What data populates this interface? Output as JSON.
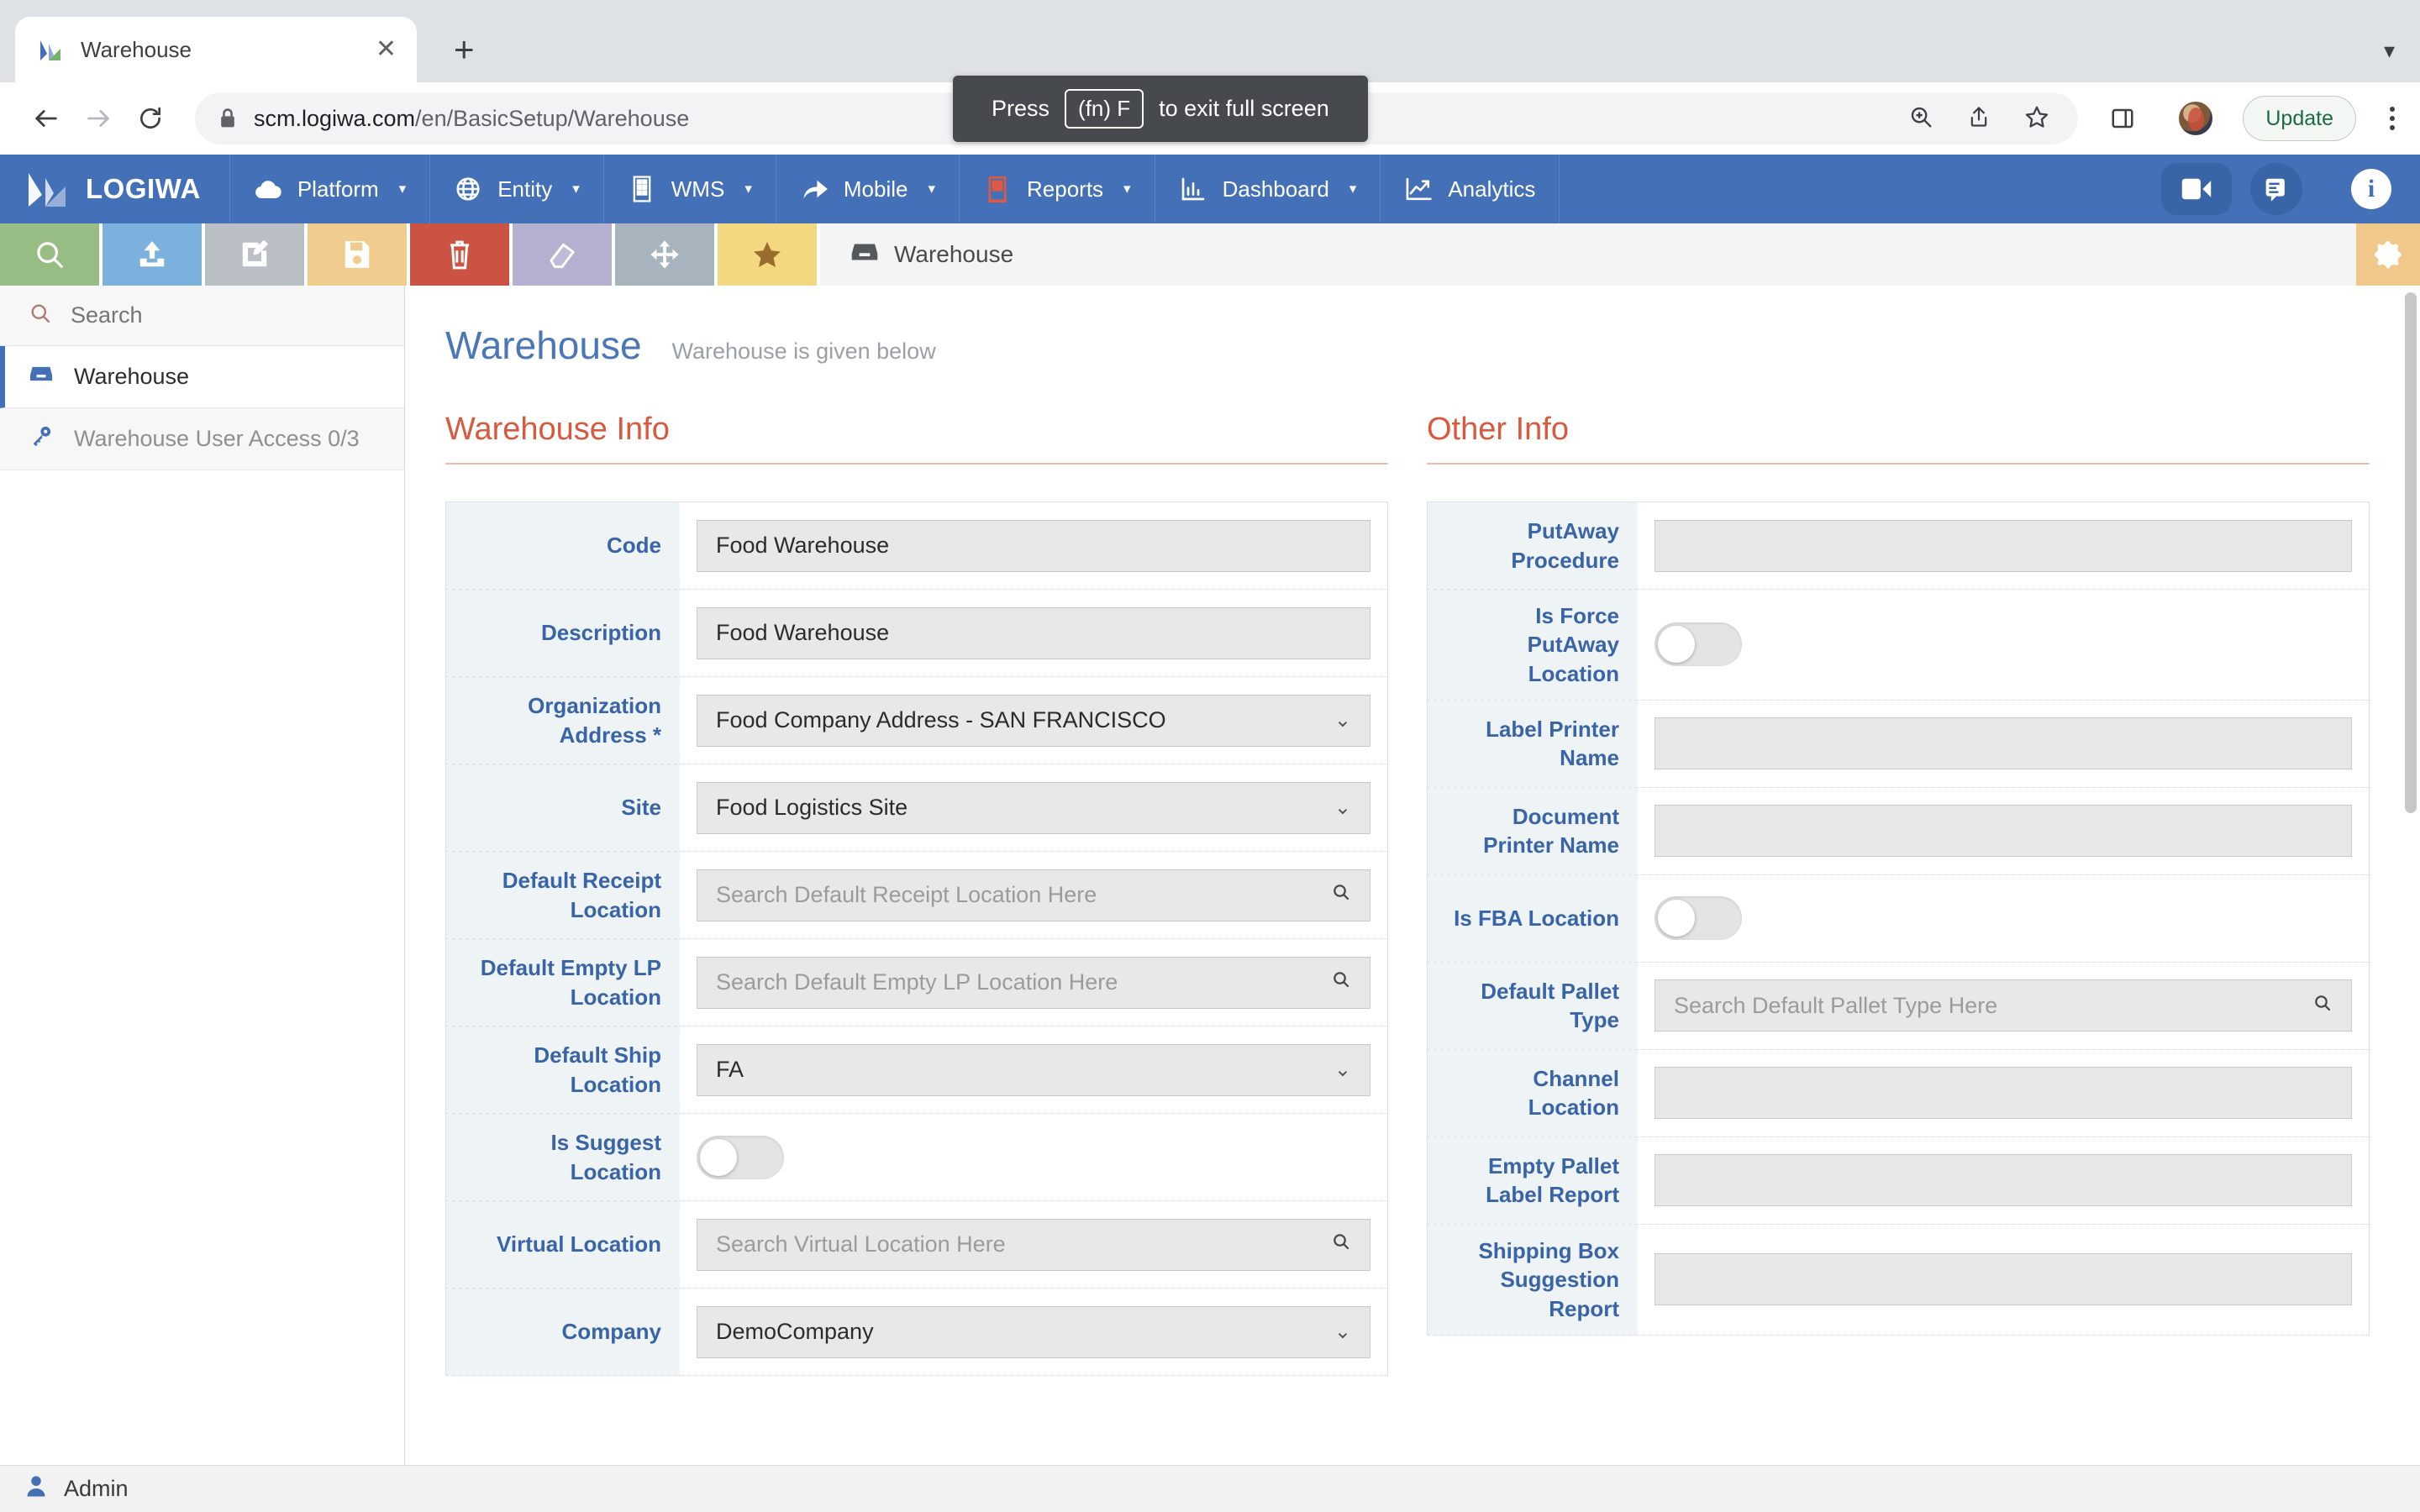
{
  "browser": {
    "tab": {
      "title": "Warehouse",
      "favicon_icon": "logiwa-favicon",
      "close_icon": "close-icon"
    },
    "new_tab_label": "+",
    "tabstrip_menu_icon": "chevron-down-icon",
    "nav": {
      "back_icon": "back-arrow-icon",
      "forward_icon": "forward-arrow-icon",
      "reload_icon": "reload-icon"
    },
    "omnibox": {
      "lock_icon": "lock-icon",
      "url_host": "scm.logiwa.com",
      "url_path": "/en/BasicSetup/Warehouse",
      "zoom_icon": "zoom-in-icon",
      "share_icon": "share-icon",
      "bookmark_icon": "star-outline-icon"
    },
    "right": {
      "sidepanel_icon": "side-panel-icon",
      "avatar_icon": "profile-avatar",
      "update_label": "Update",
      "menu_icon": "kebab-menu-icon"
    },
    "fullscreen_toast": {
      "prefix": "Press",
      "key": "(fn) F",
      "suffix": "to exit full screen"
    }
  },
  "app_nav": {
    "brand": "LOGIWA",
    "brand_icon": "logiwa-logo",
    "items": [
      {
        "label": "Platform",
        "icon": "cloud-icon",
        "caret": "▾"
      },
      {
        "label": "Entity",
        "icon": "globe-icon",
        "caret": "▾"
      },
      {
        "label": "WMS",
        "icon": "building-icon",
        "caret": "▾"
      },
      {
        "label": "Mobile",
        "icon": "share-arrow-icon",
        "caret": "▾"
      },
      {
        "label": "Reports",
        "icon": "report-building-icon",
        "caret": "▾"
      },
      {
        "label": "Dashboard",
        "icon": "bar-chart-icon",
        "caret": "▾"
      },
      {
        "label": "Analytics",
        "icon": "line-chart-icon",
        "caret": ""
      }
    ],
    "actions": {
      "video_icon": "video-camera-icon",
      "chat_icon": "chat-bubble-icon",
      "info_icon": "info-icon",
      "info_label": "i"
    },
    "accent_color": "#4470b8"
  },
  "action_bar": {
    "buttons": [
      {
        "name": "search",
        "icon": "magnifier-icon",
        "color": "#97bd84"
      },
      {
        "name": "upload",
        "icon": "upload-icon",
        "color": "#7cb0dd"
      },
      {
        "name": "edit",
        "icon": "edit-pencil-icon",
        "color": "#b9bfc4"
      },
      {
        "name": "save",
        "icon": "save-disk-icon",
        "color": "#f0cc8e"
      },
      {
        "name": "delete",
        "icon": "trash-icon",
        "color": "#ca5344"
      },
      {
        "name": "clear",
        "icon": "eraser-icon",
        "color": "#b3b1cf"
      },
      {
        "name": "move",
        "icon": "move-arrows-icon",
        "color": "#a7b3bd"
      },
      {
        "name": "favorite",
        "icon": "star-filled-icon",
        "color": "#f4d781"
      }
    ],
    "breadcrumb": {
      "icon": "warehouse-box-icon",
      "label": "Warehouse"
    },
    "settings_icon": "gear-icon"
  },
  "sidebar": {
    "search": {
      "placeholder": "Search",
      "icon": "search-icon",
      "value": ""
    },
    "items": [
      {
        "label": "Warehouse",
        "icon": "warehouse-box-icon",
        "active": true
      },
      {
        "label": "Warehouse User Access 0/3",
        "icon": "key-icon",
        "active": false
      }
    ]
  },
  "page": {
    "title": "Warehouse",
    "subtitle": "Warehouse is given below"
  },
  "warehouse_info": {
    "section_title": "Warehouse Info",
    "rows": [
      {
        "label": "Code",
        "type": "text",
        "value": "Food Warehouse",
        "placeholder": ""
      },
      {
        "label": "Description",
        "type": "text",
        "value": "Food Warehouse",
        "placeholder": ""
      },
      {
        "label": "Organization Address *",
        "type": "select",
        "value": "Food Company Address - SAN FRANCISCO",
        "placeholder": ""
      },
      {
        "label": "Site",
        "type": "select",
        "value": "Food Logistics Site",
        "placeholder": ""
      },
      {
        "label": "Default Receipt Location",
        "type": "search",
        "value": "",
        "placeholder": "Search Default Receipt Location Here"
      },
      {
        "label": "Default Empty LP Location",
        "type": "search",
        "value": "",
        "placeholder": "Search Default Empty LP Location Here"
      },
      {
        "label": "Default Ship Location",
        "type": "select",
        "value": "FA",
        "placeholder": ""
      },
      {
        "label": "Is Suggest Location",
        "type": "toggle",
        "value": "off",
        "placeholder": ""
      },
      {
        "label": "Virtual Location",
        "type": "search",
        "value": "",
        "placeholder": "Search Virtual Location Here"
      },
      {
        "label": "Company",
        "type": "select",
        "value": "DemoCompany",
        "placeholder": ""
      }
    ]
  },
  "other_info": {
    "section_title": "Other Info",
    "rows": [
      {
        "label": "PutAway Procedure",
        "type": "text",
        "value": "",
        "placeholder": ""
      },
      {
        "label": "Is Force PutAway Location",
        "type": "toggle",
        "value": "off",
        "placeholder": ""
      },
      {
        "label": "Label Printer Name",
        "type": "text",
        "value": "",
        "placeholder": ""
      },
      {
        "label": "Document Printer Name",
        "type": "text",
        "value": "",
        "placeholder": ""
      },
      {
        "label": "Is FBA Location",
        "type": "toggle",
        "value": "off",
        "placeholder": ""
      },
      {
        "label": "Default Pallet Type",
        "type": "search",
        "value": "",
        "placeholder": "Search Default Pallet Type Here"
      },
      {
        "label": "Channel Location",
        "type": "text",
        "value": "",
        "placeholder": ""
      },
      {
        "label": "Empty Pallet Label Report",
        "type": "text",
        "value": "",
        "placeholder": ""
      },
      {
        "label": "Shipping Box Suggestion Report",
        "type": "text",
        "value": "",
        "placeholder": ""
      }
    ]
  },
  "footer": {
    "user": "Admin",
    "user_icon": "user-icon"
  }
}
